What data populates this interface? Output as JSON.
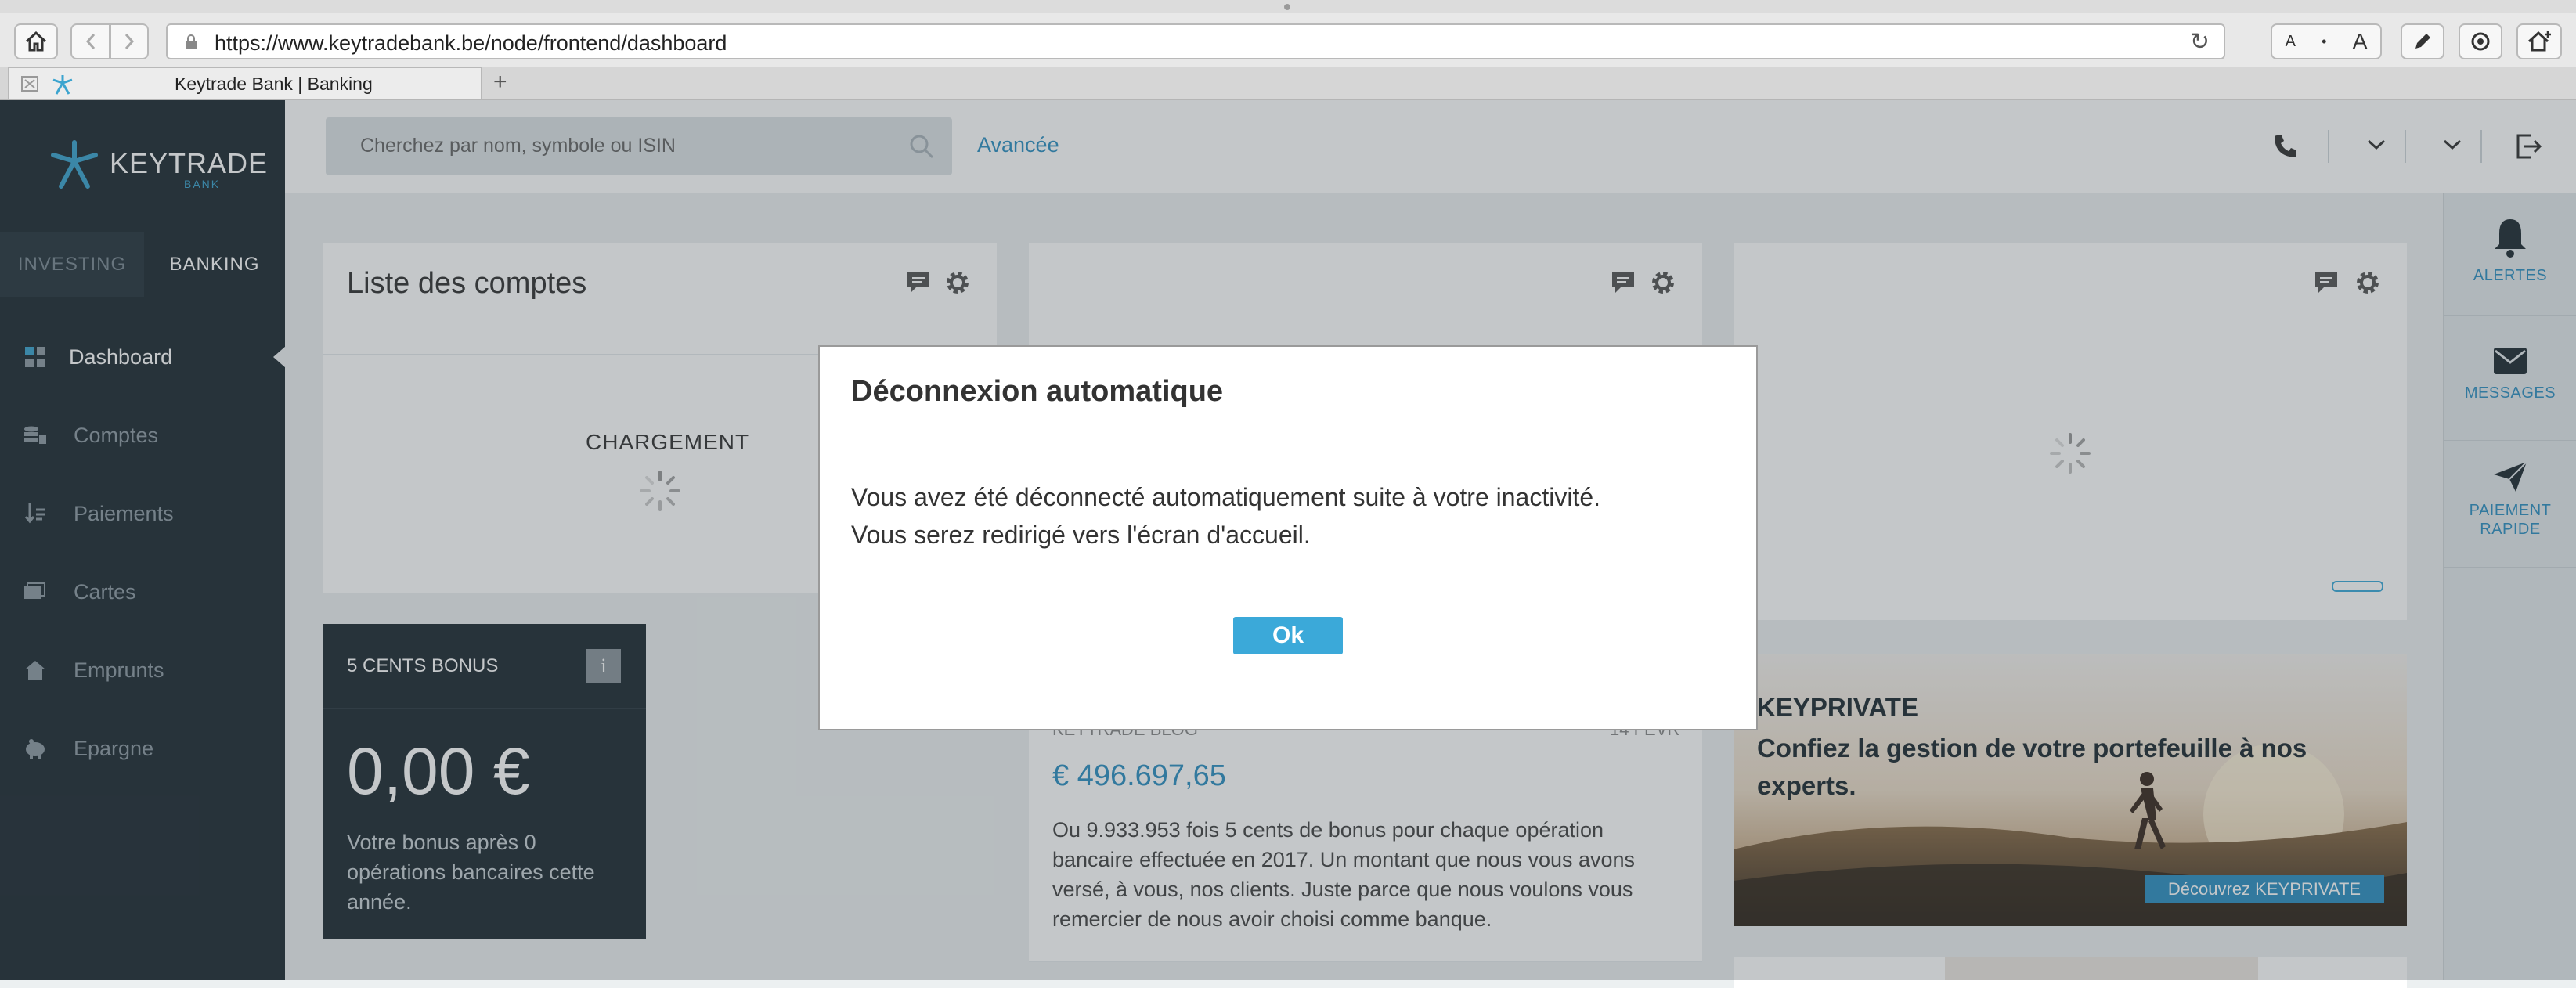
{
  "browser": {
    "url": "https://www.keytradebank.be/node/frontend/dashboard",
    "tab_title": "Keytrade Bank | Banking",
    "font_small": "A",
    "font_large": "A",
    "new_tab": "+"
  },
  "brand": {
    "name": "KEYTRADE",
    "sub": "BANK"
  },
  "switch": {
    "investing": "INVESTING",
    "banking": "BANKING"
  },
  "nav": [
    {
      "label": "Dashboard",
      "icon": "dashboard-icon"
    },
    {
      "label": "Comptes",
      "icon": "coins-icon"
    },
    {
      "label": "Paiements",
      "icon": "transfer-icon"
    },
    {
      "label": "Cartes",
      "icon": "card-icon"
    },
    {
      "label": "Emprunts",
      "icon": "house-icon"
    },
    {
      "label": "Epargne",
      "icon": "piggy-icon"
    }
  ],
  "search": {
    "placeholder": "Cherchez par nom, symbole ou ISIN",
    "advanced": "Avancée"
  },
  "rightbar": {
    "alerts": "ALERTES",
    "messages": "MESSAGES",
    "payment_1": "PAIEMENT",
    "payment_2": "RAPIDE"
  },
  "accounts_card": {
    "title": "Liste des comptes",
    "loading": "CHARGEMENT"
  },
  "bonus": {
    "title": "5 CENTS BONUS",
    "info": "i",
    "amount": "0,00 €",
    "desc": "Votre bonus après 0 opérations bancaires cette année."
  },
  "blog": {
    "source": "KEYTRADE BLOG",
    "date": "14 FÉVR",
    "amount": "€ 496.697,65",
    "text": "Ou 9.933.953 fois 5 cents de bonus pour chaque opération bancaire effectuée en 2017. Un montant que nous vous avons versé, à vous, nos clients. Juste parce que nous voulons vous remercier de nous avoir choisi comme banque."
  },
  "promo": {
    "title": "KEYPRIVATE",
    "subtitle": "Confiez la gestion de votre portefeuille à nos experts.",
    "button": "Découvrez KEYPRIVATE"
  },
  "modal": {
    "title": "Déconnexion automatique",
    "line1": "Vous avez été déconnecté automatiquement suite à votre inactivité.",
    "line2": "Vous serez redirigé vers l'écran d'accueil.",
    "ok": "Ok"
  },
  "colors": {
    "sidebar": "#1f2b33",
    "accent": "#2f90c2",
    "ok_button": "#3ba9d9"
  }
}
